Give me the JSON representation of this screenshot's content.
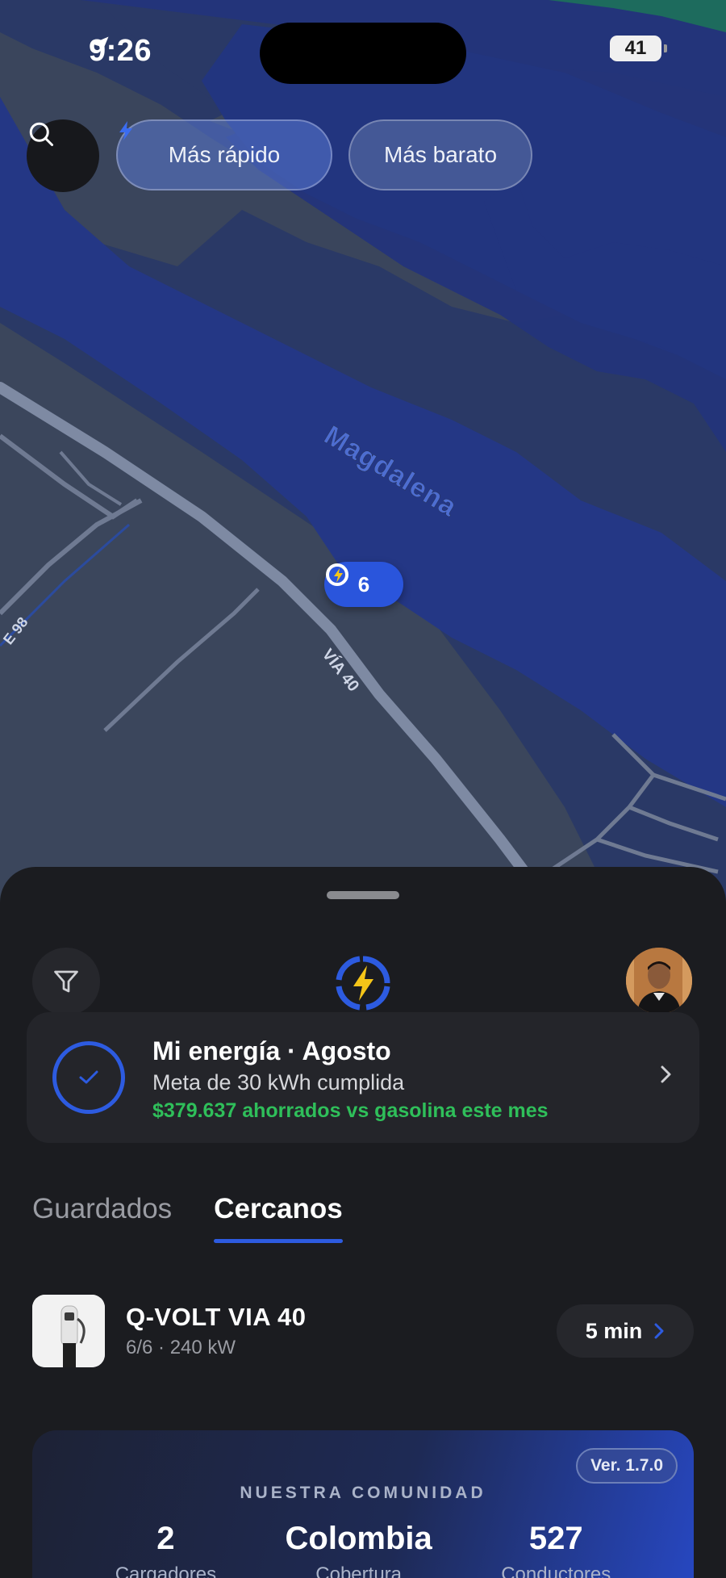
{
  "status_bar": {
    "time": "9:26",
    "battery": "41"
  },
  "filters": {
    "fast_label": "Más rápido",
    "cheap_label": "Más barato"
  },
  "map": {
    "river_label": "Magdalena",
    "road_via40": "VÍA 40",
    "road_98": "E 98",
    "station_pin_count": "6"
  },
  "energy": {
    "title": "Mi energía · Agosto",
    "goal": "Meta de 30 kWh cumplida",
    "saved": "$379.637 ahorrados vs gasolina este mes"
  },
  "tabs": [
    {
      "label": "Guardados",
      "active": false
    },
    {
      "label": "Cercanos",
      "active": true
    }
  ],
  "station": {
    "name": "Q-VOLT VIA 40",
    "meta": "6/6 · 240 kW",
    "eta": "5 min"
  },
  "community": {
    "title": "NUESTRA COMUNIDAD",
    "version": "Ver. 1.7.0",
    "stats": [
      {
        "value": "2",
        "label": "Cargadores"
      },
      {
        "value": "Colombia",
        "label": "Cobertura"
      },
      {
        "value": "527",
        "label": "Conductores"
      }
    ]
  },
  "colors": {
    "accent": "#2d5be0",
    "success": "#2fbf5a",
    "bolt": "#f5c518"
  }
}
